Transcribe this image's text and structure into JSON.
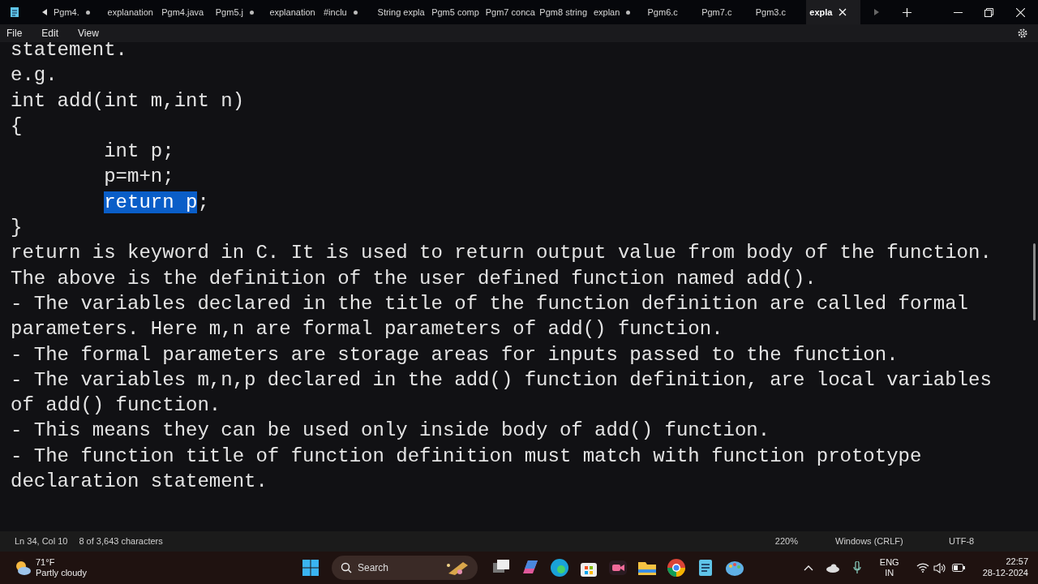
{
  "tabs": [
    {
      "label": "Pgm4.",
      "modified": true,
      "selected": false
    },
    {
      "label": "explanation",
      "modified": false,
      "selected": false
    },
    {
      "label": "Pgm4.java",
      "modified": false,
      "selected": false
    },
    {
      "label": "Pgm5.j",
      "modified": true,
      "selected": false
    },
    {
      "label": "explanation",
      "modified": false,
      "selected": false
    },
    {
      "label": "#inclu",
      "modified": true,
      "selected": false
    },
    {
      "label": "String expla",
      "modified": false,
      "selected": false
    },
    {
      "label": "Pgm5 comp",
      "modified": false,
      "selected": false
    },
    {
      "label": "Pgm7 conca",
      "modified": false,
      "selected": false
    },
    {
      "label": "Pgm8 string",
      "modified": false,
      "selected": false
    },
    {
      "label": "explan",
      "modified": true,
      "selected": false
    },
    {
      "label": "Pgm6.c",
      "modified": false,
      "selected": false
    },
    {
      "label": "Pgm7.c",
      "modified": false,
      "selected": false
    },
    {
      "label": "Pgm3.c",
      "modified": false,
      "selected": false
    },
    {
      "label": "expla",
      "modified": false,
      "selected": true
    }
  ],
  "menu": [
    "File",
    "Edit",
    "View"
  ],
  "lines": [
    {
      "text": "statement."
    },
    {
      "text": "e.g."
    },
    {
      "text": "int add(int m,int n)"
    },
    {
      "text": "{"
    },
    {
      "text": "int p;",
      "indented": true
    },
    {
      "text": "p=m+n;",
      "indented": true
    },
    {
      "indented": true,
      "segments": [
        {
          "text": "return p",
          "selected": true
        },
        {
          "text": ";",
          "selected": false
        }
      ]
    },
    {
      "text": "}"
    },
    {
      "text": "return is keyword in C. It is used to return output value from body of the function."
    },
    {
      "text": "The above is the definition of the user defined function named add()."
    },
    {
      "text": "- The variables declared in the title of the function definition are called formal"
    },
    {
      "text": "parameters. Here m,n are formal parameters of add() function."
    },
    {
      "text": "- The formal parameters are storage areas for inputs passed to the function."
    },
    {
      "text": "- The variables m,n,p declared in the add() function definition, are local variables"
    },
    {
      "text": "of add() function."
    },
    {
      "text": "- This means they can be used only inside body of add() function."
    },
    {
      "text": "- The function title of function definition must match with function prototype"
    },
    {
      "text": "declaration statement."
    }
  ],
  "status_bar": {
    "position": "Ln 34, Col 10",
    "characters": "8 of 3,643 characters",
    "zoom": "220%",
    "line_ending": "Windows (CRLF)",
    "encoding": "UTF-8"
  },
  "taskbar": {
    "temperature": "71°F",
    "weather": "Partly cloudy",
    "search": {
      "placeholder": "Search"
    },
    "language": "ENG",
    "region": "IN",
    "time": "22:57",
    "date": "28-12-2024"
  }
}
